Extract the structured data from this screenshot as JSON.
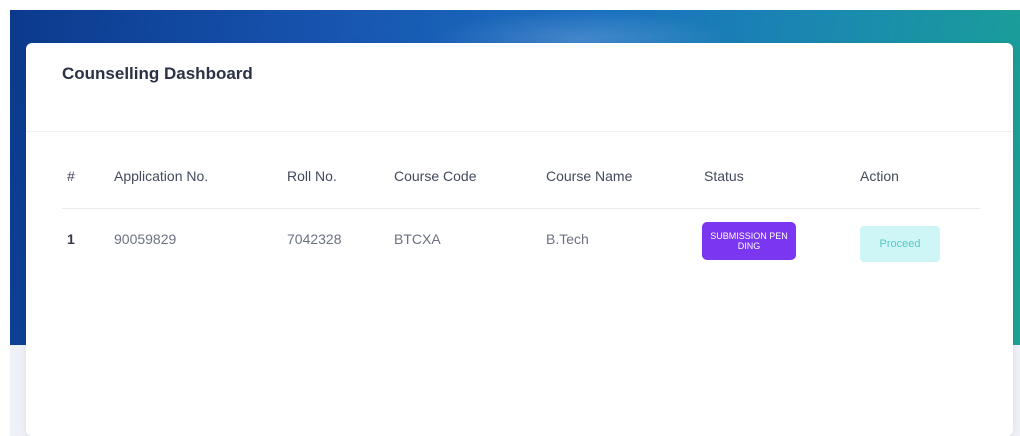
{
  "dashboard": {
    "title": "Counselling Dashboard"
  },
  "table": {
    "columns": [
      "#",
      "Application No.",
      "Roll No.",
      "Course Code",
      "Course Name",
      "Status",
      "Action"
    ],
    "rows": [
      {
        "index": "1",
        "application_no": "90059829",
        "roll_no": "7042328",
        "course_code": "BTCXA",
        "course_name": "B.Tech",
        "status": "SUBMISSION PENDING",
        "action": "Proceed"
      }
    ]
  },
  "colors": {
    "status_badge": "#7a36f0",
    "proceed_button_bg": "#cff6f6",
    "proceed_button_text": "#56c7c4",
    "hero_start": "#0b3a8c",
    "hero_end": "#1aa394"
  }
}
